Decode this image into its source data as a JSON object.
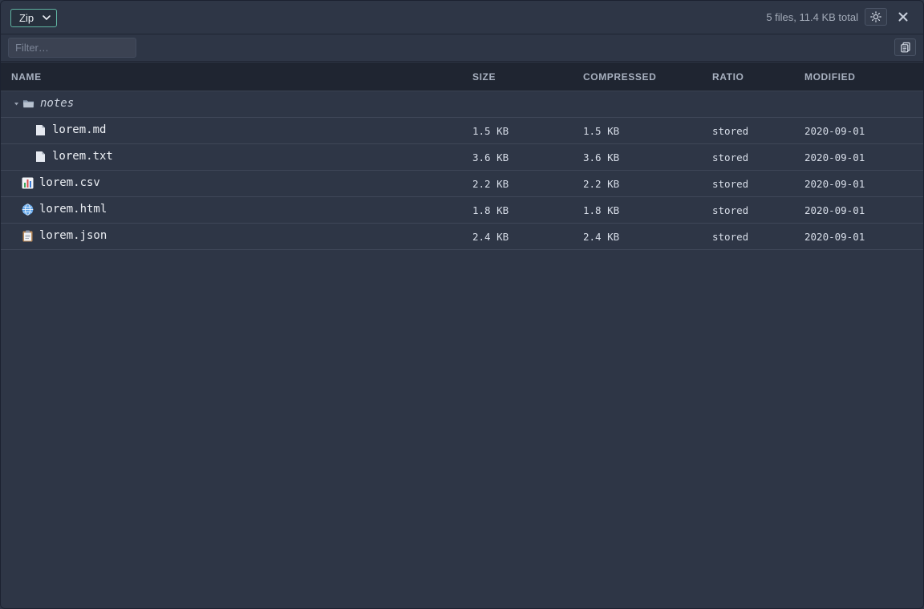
{
  "toolbar": {
    "format_select": "Zip",
    "summary": "5 files, 11.4 KB total",
    "filter_placeholder": "Filter…"
  },
  "columns": {
    "name": "NAME",
    "size": "SIZE",
    "compressed": "COMPRESSED",
    "ratio": "RATIO",
    "modified": "MODIFIED"
  },
  "folder": {
    "name": "notes",
    "icon": "folder-icon"
  },
  "rows": [
    {
      "name": "lorem.md",
      "size": "1.5 KB",
      "compressed": "1.5 KB",
      "ratio": "stored",
      "modified": "2020-09-01",
      "icon": "file-icon"
    },
    {
      "name": "lorem.txt",
      "size": "3.6 KB",
      "compressed": "3.6 KB",
      "ratio": "stored",
      "modified": "2020-09-01",
      "icon": "file-icon"
    },
    {
      "name": "lorem.csv",
      "size": "2.2 KB",
      "compressed": "2.2 KB",
      "ratio": "stored",
      "modified": "2020-09-01",
      "icon": "chart-icon"
    },
    {
      "name": "lorem.html",
      "size": "1.8 KB",
      "compressed": "1.8 KB",
      "ratio": "stored",
      "modified": "2020-09-01",
      "icon": "globe-icon"
    },
    {
      "name": "lorem.json",
      "size": "2.4 KB",
      "compressed": "2.4 KB",
      "ratio": "stored",
      "modified": "2020-09-01",
      "icon": "clipboard-icon"
    }
  ],
  "colors": {
    "background": "#2e3646",
    "header_background": "#1f2531",
    "accent": "#5fb3a1"
  }
}
